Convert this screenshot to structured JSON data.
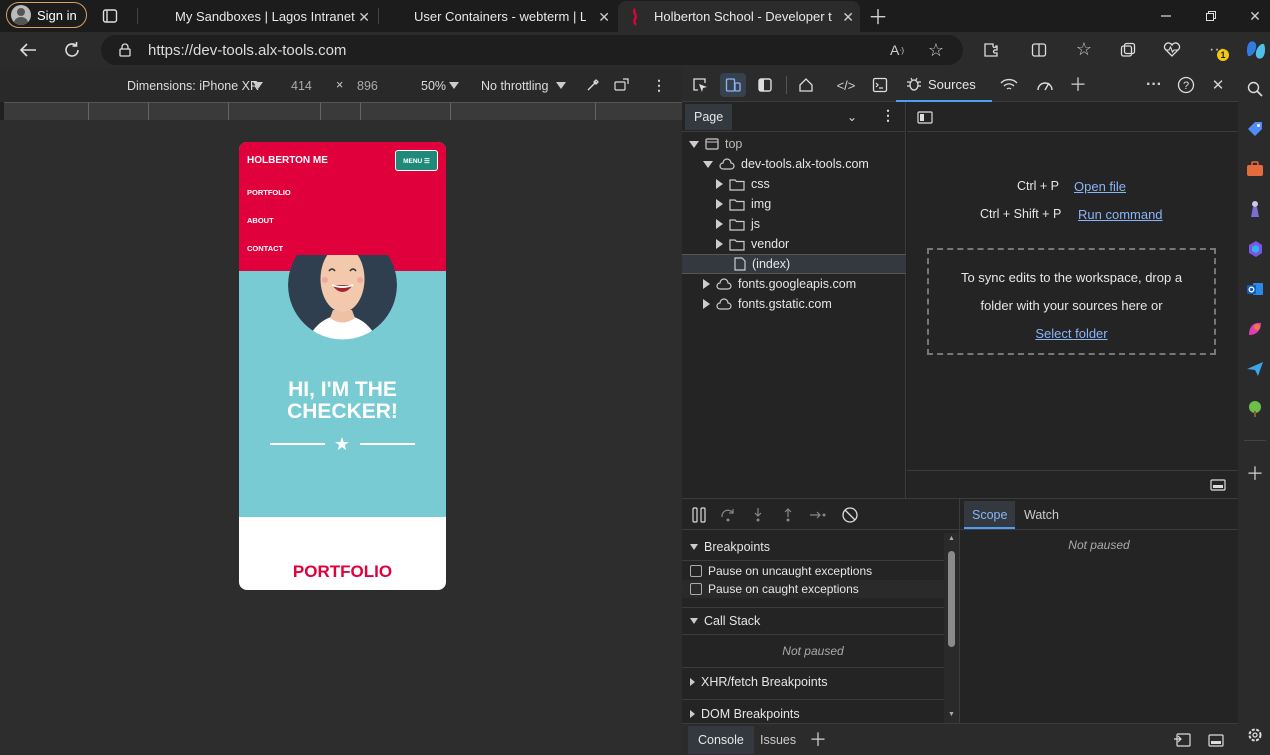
{
  "browser": {
    "signin_label": "Sign in",
    "tabs": [
      {
        "title": "My Sandboxes | Lagos Intranet"
      },
      {
        "title": "User Containers - webterm | Lago"
      },
      {
        "title": "Holberton School - Developer to"
      }
    ],
    "url": "https://dev-tools.alx-tools.com",
    "badge_count": "1"
  },
  "device_toolbar": {
    "dimensions_label": "Dimensions: iPhone XR",
    "width": "414",
    "times": "×",
    "height": "896",
    "zoom": "50%",
    "throttling": "No throttling"
  },
  "phone": {
    "brand": "HOLBERTON ME",
    "menu_label": "MENU ☰",
    "nav_items": [
      "PORTFOLIO",
      "ABOUT",
      "CONTACT"
    ],
    "hero_title_line1": "HI, I'M THE",
    "hero_title_line2": "CHECKER!",
    "section_title": "PORTFOLIO",
    "colors": {
      "nav": "#e0003c",
      "hero": "#78cbd2",
      "menu_button": "#1f8a7a"
    }
  },
  "devtools": {
    "sources_tab": "Sources",
    "page_tab": "Page",
    "tree": {
      "top": "top",
      "domain": "dev-tools.alx-tools.com",
      "folders": [
        "css",
        "img",
        "js",
        "vendor"
      ],
      "index": "(index)",
      "others": [
        "fonts.googleapis.com",
        "fonts.gstatic.com"
      ]
    },
    "editor": {
      "shortcut1": "Ctrl + P",
      "action1": "Open file",
      "shortcut2": "Ctrl + Shift + P",
      "action2": "Run command",
      "drop_text_line1": "To sync edits to the workspace, drop a",
      "drop_text_line2": "folder with your sources here or",
      "select_folder": "Select folder"
    },
    "debugger": {
      "breakpoints": "Breakpoints",
      "pause_uncaught": "Pause on uncaught exceptions",
      "pause_caught": "Pause on caught exceptions",
      "call_stack": "Call Stack",
      "not_paused": "Not paused",
      "xhr": "XHR/fetch Breakpoints",
      "dom": "DOM Breakpoints",
      "scope": "Scope",
      "watch": "Watch",
      "scope_not_paused": "Not paused"
    },
    "drawer": {
      "console": "Console",
      "issues": "Issues"
    }
  }
}
